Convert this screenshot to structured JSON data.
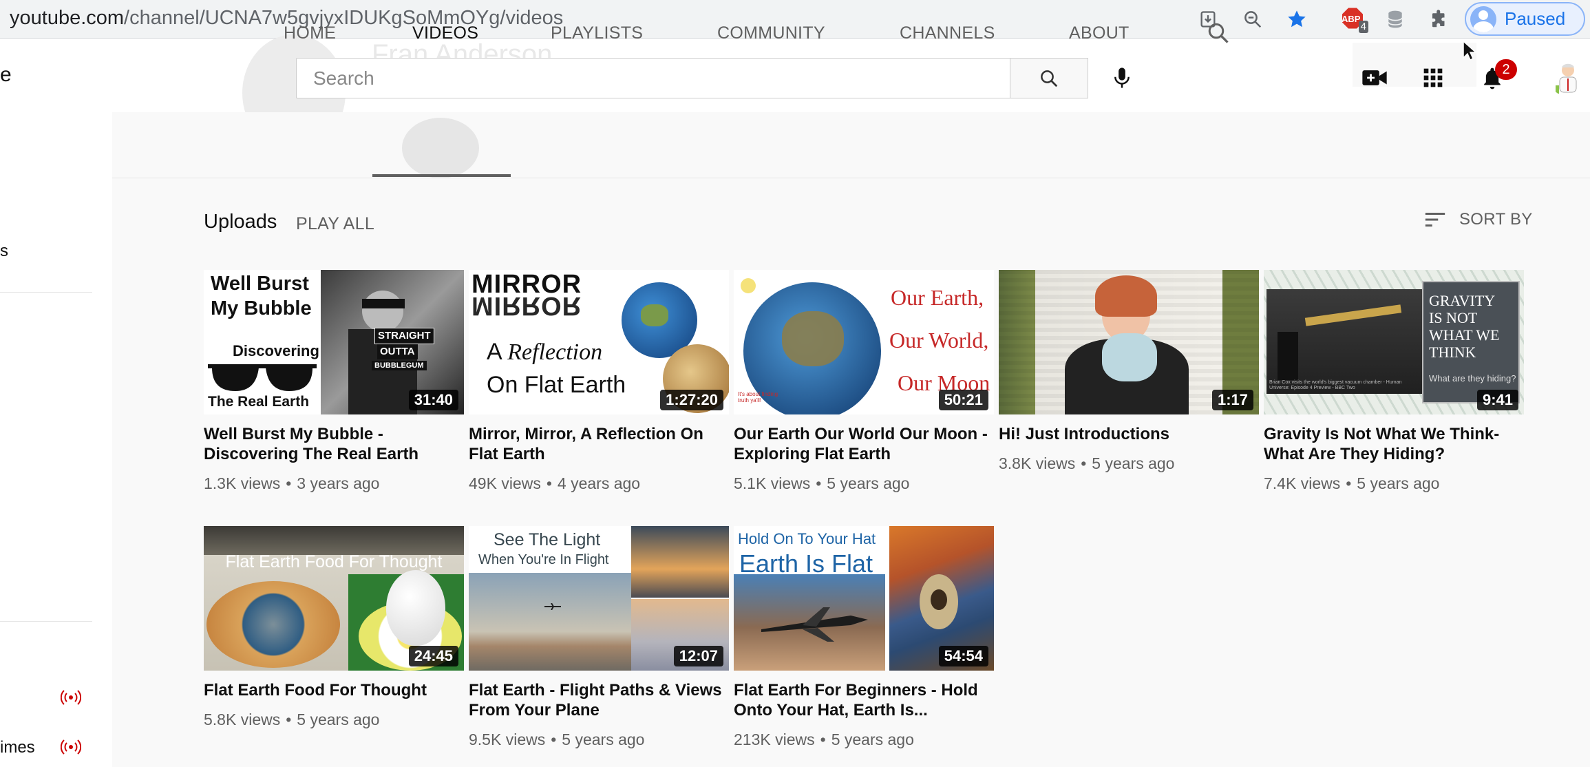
{
  "browser": {
    "url_host": "youtube.com",
    "url_path": "/channel/UCNA7w5gvjyxIDUKgSoMmOYg/videos",
    "abp_label": "ABP",
    "abp_count": "4",
    "profile_status": "Paused"
  },
  "masthead": {
    "search_placeholder": "Search",
    "notifications_count": "2",
    "ghost_channel_name": "Fran Anderson"
  },
  "sidebar": {
    "item_partial_1": "s",
    "item_partial_2": "imes",
    "logo_partial": "e"
  },
  "tabs": [
    {
      "label": "HOME"
    },
    {
      "label": "VIDEOS"
    },
    {
      "label": "PLAYLISTS"
    },
    {
      "label": "COMMUNITY"
    },
    {
      "label": "CHANNELS"
    },
    {
      "label": "ABOUT"
    }
  ],
  "section": {
    "title": "Uploads",
    "play_all": "PLAY ALL",
    "sort_by": "SORT BY"
  },
  "videos": [
    {
      "title": "Well Burst My Bubble - Discovering The Real Earth",
      "views": "1.3K views",
      "age": "3 years ago",
      "duration": "31:40",
      "thumb_text": [
        "Well Burst",
        "My Bubble",
        "Discovering",
        "The Real Earth",
        "STRAIGHT",
        "OUTTA",
        "BUBBLEGUM"
      ]
    },
    {
      "title": "Mirror, Mirror, A Reflection On Flat Earth",
      "views": "49K views",
      "age": "4 years ago",
      "duration": "1:27:20",
      "thumb_text": [
        "MIRROR",
        "MIRROR",
        "A",
        "Reflection",
        "On Flat Earth"
      ]
    },
    {
      "title": "Our Earth Our World Our Moon - Exploring Flat Earth",
      "views": "5.1K views",
      "age": "5 years ago",
      "duration": "50:21",
      "thumb_text": [
        "Our Earth,",
        "Our World,",
        "Our Moon",
        "It's about finding truth ya'll!"
      ]
    },
    {
      "title": "Hi! Just Introductions",
      "views": "3.8K views",
      "age": "5 years ago",
      "duration": "1:17",
      "thumb_text": []
    },
    {
      "title": "Gravity Is Not What We Think- What Are They Hiding?",
      "views": "7.4K views",
      "age": "5 years ago",
      "duration": "9:41",
      "thumb_text": [
        "GRAVITY",
        "IS NOT",
        "WHAT WE",
        "THINK",
        "What are they hiding?",
        "Brian Cox visits the world's biggest vacuum chamber - Human Universe: Episode 4 Preview - BBC Two"
      ]
    },
    {
      "title": "Flat Earth Food For Thought",
      "views": "5.8K views",
      "age": "5 years ago",
      "duration": "24:45",
      "thumb_text": [
        "Flat Earth Food For Thought"
      ]
    },
    {
      "title": "Flat Earth - Flight Paths & Views From Your Plane",
      "views": "9.5K views",
      "age": "5 years ago",
      "duration": "12:07",
      "thumb_text": [
        "See The Light",
        "When You're In Flight"
      ]
    },
    {
      "title": "Flat Earth For Beginners - Hold Onto Your Hat, Earth Is...",
      "views": "213K views",
      "age": "5 years ago",
      "duration": "54:54",
      "thumb_text": [
        "Hold On To Your Hat",
        "Earth Is Flat"
      ]
    }
  ],
  "colors": {
    "accent_blue": "#1a73e8",
    "badge_red": "#cc0000",
    "live_red": "#cc0000",
    "text_primary": "#0f0f0f",
    "text_secondary": "#606060"
  }
}
